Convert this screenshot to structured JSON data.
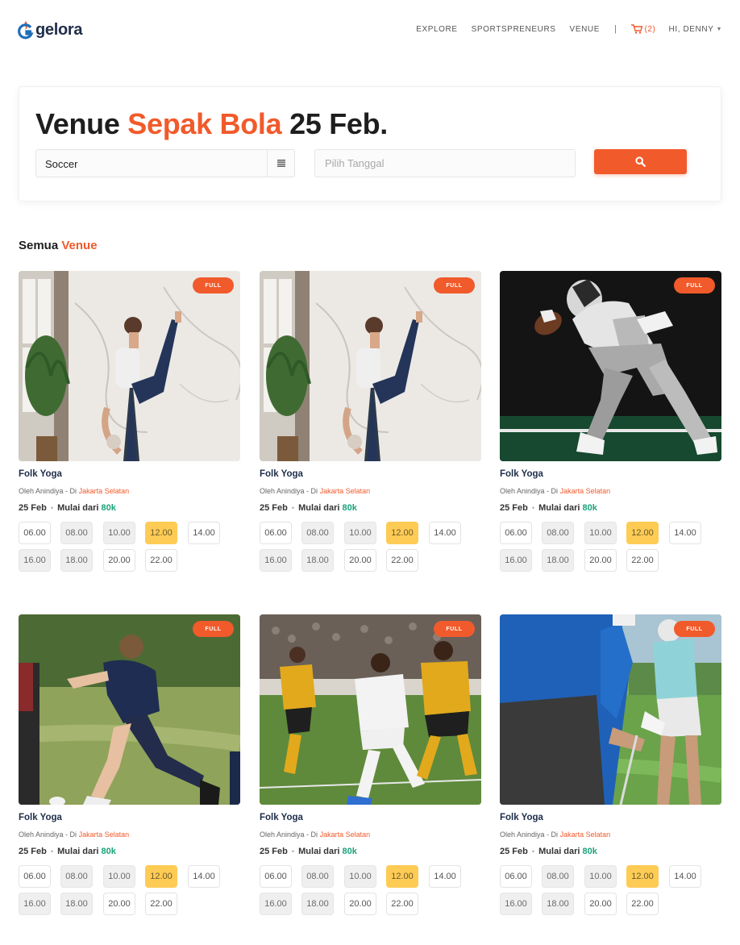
{
  "nav": {
    "logo_text": "gelora",
    "links": [
      "EXPLORE",
      "SPORTSPRENEURS",
      "VENUE"
    ],
    "separator": "|",
    "cart_count": "(2)",
    "user": "HI, DENNY"
  },
  "hero": {
    "title_prefix": "Venue",
    "title_sport": "Sepak Bola",
    "title_date": "25 Feb.",
    "sport_value": "Soccer",
    "date_placeholder": "Pilih Tanggal"
  },
  "section": {
    "title_prefix": "Semua",
    "title_accent": "Venue"
  },
  "colors": {
    "accent": "#f15a2b",
    "price": "#1aa37a",
    "active_slot": "#fecb55",
    "navy": "#1f2d4a"
  },
  "venues": [
    {
      "image": "yoga",
      "badge": "FULL",
      "title": "Folk Yoga",
      "meta_prefix": "Oleh Anindiya - Di",
      "location": "Jakarta Selatan",
      "date": "25 Feb",
      "dot": "•",
      "price_label": "Mulai dari",
      "price": "80k",
      "slots": [
        {
          "time": "06.00",
          "state": "open"
        },
        {
          "time": "08.00",
          "state": "booked"
        },
        {
          "time": "10.00",
          "state": "booked"
        },
        {
          "time": "12.00",
          "state": "active"
        },
        {
          "time": "14.00",
          "state": "open"
        },
        {
          "time": "16.00",
          "state": "booked"
        },
        {
          "time": "18.00",
          "state": "booked"
        },
        {
          "time": "20.00",
          "state": "open"
        },
        {
          "time": "22.00",
          "state": "open"
        }
      ]
    },
    {
      "image": "yoga",
      "badge": "FULL",
      "title": "Folk Yoga",
      "meta_prefix": "Oleh Anindiya - Di",
      "location": "Jakarta Selatan",
      "date": "25 Feb",
      "dot": "•",
      "price_label": "Mulai dari",
      "price": "80k",
      "slots": [
        {
          "time": "06.00",
          "state": "open"
        },
        {
          "time": "08.00",
          "state": "booked"
        },
        {
          "time": "10.00",
          "state": "booked"
        },
        {
          "time": "12.00",
          "state": "active"
        },
        {
          "time": "14.00",
          "state": "open"
        },
        {
          "time": "16.00",
          "state": "booked"
        },
        {
          "time": "18.00",
          "state": "booked"
        },
        {
          "time": "20.00",
          "state": "open"
        },
        {
          "time": "22.00",
          "state": "open"
        }
      ]
    },
    {
      "image": "football",
      "badge": "FULL",
      "title": "Folk Yoga",
      "meta_prefix": "Oleh Anindiya - Di",
      "location": "Jakarta Selatan",
      "date": "25 Feb",
      "dot": "•",
      "price_label": "Mulai dari",
      "price": "80k",
      "slots": [
        {
          "time": "06.00",
          "state": "open"
        },
        {
          "time": "08.00",
          "state": "booked"
        },
        {
          "time": "10.00",
          "state": "booked"
        },
        {
          "time": "12.00",
          "state": "active"
        },
        {
          "time": "14.00",
          "state": "open"
        },
        {
          "time": "16.00",
          "state": "booked"
        },
        {
          "time": "18.00",
          "state": "booked"
        },
        {
          "time": "20.00",
          "state": "open"
        },
        {
          "time": "22.00",
          "state": "open"
        }
      ]
    },
    {
      "image": "soccer-kick",
      "badge": "FULL",
      "title": "Folk Yoga",
      "meta_prefix": "Oleh Anindiya - Di",
      "location": "Jakarta Selatan",
      "date": "25 Feb",
      "dot": "•",
      "price_label": "Mulai dari",
      "price": "80k",
      "slots": [
        {
          "time": "06.00",
          "state": "open"
        },
        {
          "time": "08.00",
          "state": "booked"
        },
        {
          "time": "10.00",
          "state": "booked"
        },
        {
          "time": "12.00",
          "state": "active"
        },
        {
          "time": "14.00",
          "state": "open"
        },
        {
          "time": "16.00",
          "state": "booked"
        },
        {
          "time": "18.00",
          "state": "booked"
        },
        {
          "time": "20.00",
          "state": "open"
        },
        {
          "time": "22.00",
          "state": "open"
        }
      ]
    },
    {
      "image": "soccer-match",
      "badge": "FULL",
      "title": "Folk Yoga",
      "meta_prefix": "Oleh Anindiya - Di",
      "location": "Jakarta Selatan",
      "date": "25 Feb",
      "dot": "•",
      "price_label": "Mulai dari",
      "price": "80k",
      "slots": [
        {
          "time": "06.00",
          "state": "open"
        },
        {
          "time": "08.00",
          "state": "booked"
        },
        {
          "time": "10.00",
          "state": "booked"
        },
        {
          "time": "12.00",
          "state": "active"
        },
        {
          "time": "14.00",
          "state": "open"
        },
        {
          "time": "16.00",
          "state": "booked"
        },
        {
          "time": "18.00",
          "state": "booked"
        },
        {
          "time": "20.00",
          "state": "open"
        },
        {
          "time": "22.00",
          "state": "open"
        }
      ]
    },
    {
      "image": "golf",
      "badge": "FULL",
      "title": "Folk Yoga",
      "meta_prefix": "Oleh Anindiya - Di",
      "location": "Jakarta Selatan",
      "date": "25 Feb",
      "dot": "•",
      "price_label": "Mulai dari",
      "price": "80k",
      "slots": [
        {
          "time": "06.00",
          "state": "open"
        },
        {
          "time": "08.00",
          "state": "booked"
        },
        {
          "time": "10.00",
          "state": "booked"
        },
        {
          "time": "12.00",
          "state": "active"
        },
        {
          "time": "14.00",
          "state": "open"
        },
        {
          "time": "16.00",
          "state": "booked"
        },
        {
          "time": "18.00",
          "state": "booked"
        },
        {
          "time": "20.00",
          "state": "open"
        },
        {
          "time": "22.00",
          "state": "open"
        }
      ]
    }
  ]
}
